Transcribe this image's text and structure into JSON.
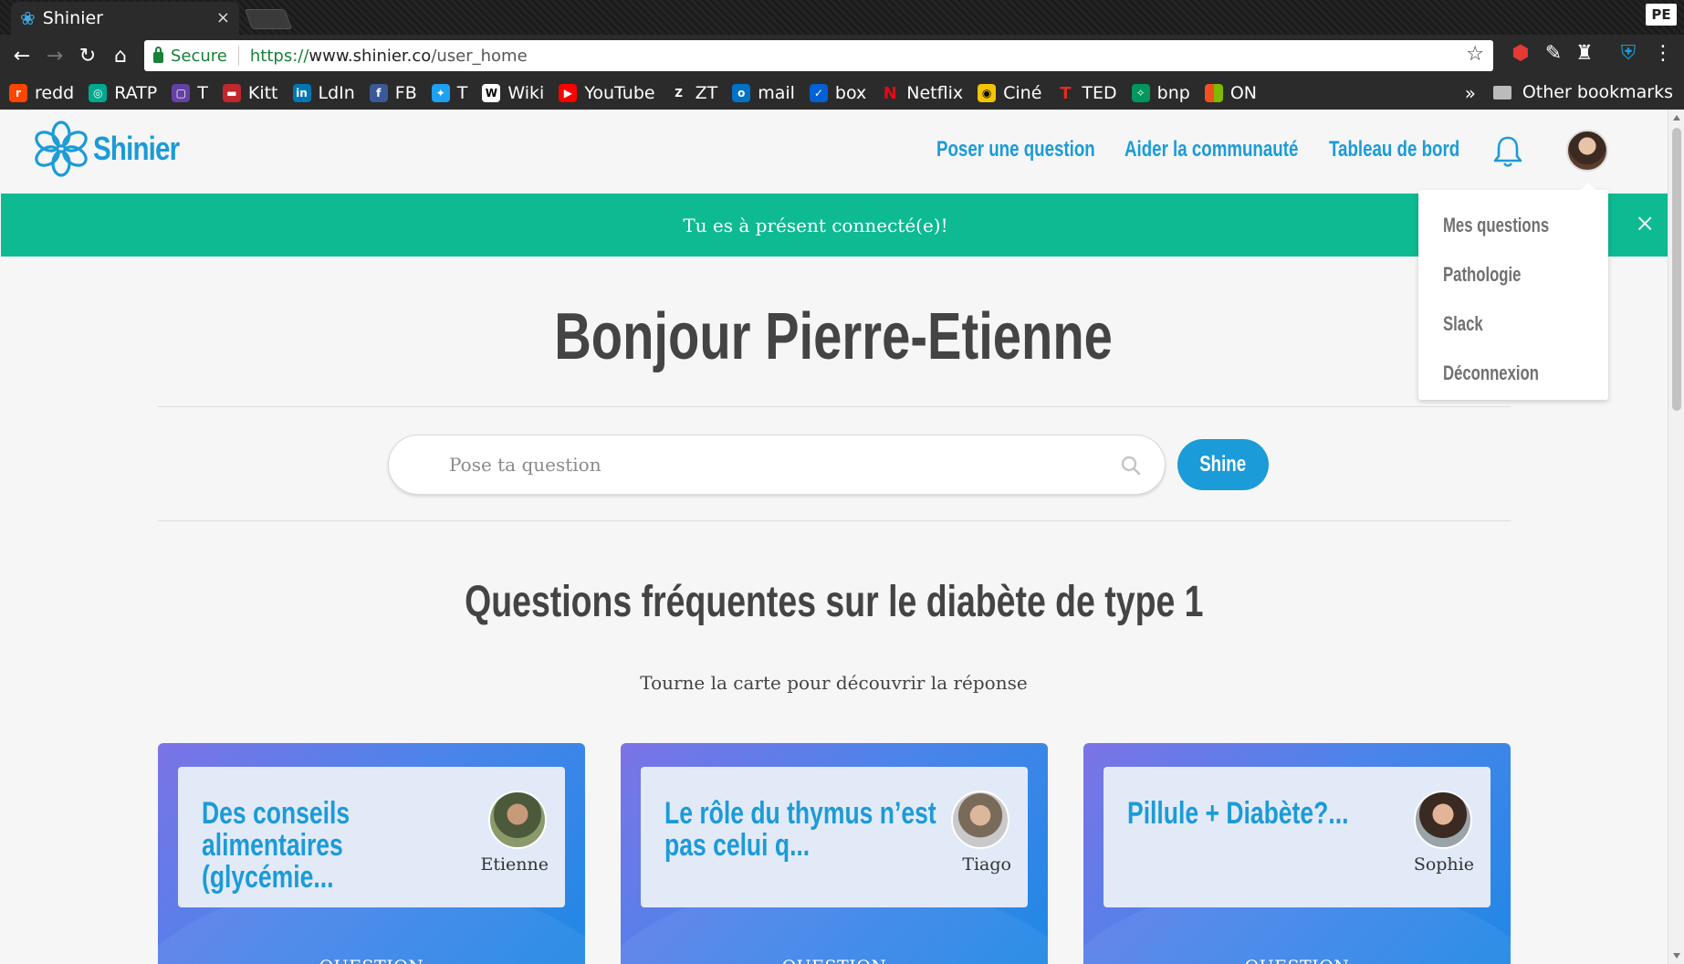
{
  "browser": {
    "tab_title": "Shinier",
    "tab_close": "×",
    "profile": "PE",
    "secure_label": "Secure",
    "url_proto": "https://",
    "url_host": "www.shinier.co",
    "url_path": "/user_home",
    "bookmarks": [
      {
        "label": "redd",
        "color": "#ff4500",
        "glyph": "r"
      },
      {
        "label": "RATP",
        "color": "#00a88f",
        "glyph": "◎"
      },
      {
        "label": "T",
        "color": "#6441a5",
        "glyph": "▢"
      },
      {
        "label": "Kitt",
        "color": "#c1272d",
        "glyph": "▬"
      },
      {
        "label": "LdIn",
        "color": "#0077b5",
        "glyph": "in"
      },
      {
        "label": "FB",
        "color": "#3b5998",
        "glyph": "f"
      },
      {
        "label": "T",
        "color": "#1da1f2",
        "glyph": "✦"
      },
      {
        "label": "Wiki",
        "color": "#ffffff",
        "glyph": "W"
      },
      {
        "label": "YouTube",
        "color": "#ff0000",
        "glyph": "▶"
      },
      {
        "label": "ZT",
        "color": "#2b2b2b",
        "glyph": "Z"
      },
      {
        "label": "mail",
        "color": "#0072c6",
        "glyph": "o"
      },
      {
        "label": "box",
        "color": "#0061d5",
        "glyph": "✓"
      },
      {
        "label": "Netflix",
        "color": "#e50914",
        "glyph": "N"
      },
      {
        "label": "Ciné",
        "color": "#f5c400",
        "glyph": "◉"
      },
      {
        "label": "TED",
        "color": "#e62b1e",
        "glyph": "T"
      },
      {
        "label": "bnp",
        "color": "#00965e",
        "glyph": "✧"
      },
      {
        "label": "ON",
        "color": "#f25022",
        "glyph": "▦"
      }
    ],
    "more": "»",
    "other_bookmarks": "Other bookmarks"
  },
  "site": {
    "logo_text": "Shinier",
    "nav": {
      "ask": "Poser une question",
      "help": "Aider la communauté",
      "dashboard": "Tableau de bord"
    },
    "alert": {
      "text": "Tu es à présent connecté(e)!",
      "close": "×"
    },
    "dropdown": [
      "Mes questions",
      "Pathologie",
      "Slack",
      "Déconnexion"
    ],
    "greeting": "Bonjour Pierre-Etienne",
    "search": {
      "placeholder": "Pose ta question",
      "button": "Shine"
    },
    "faq": {
      "title": "Questions fréquentes sur le diabète de type 1",
      "subtitle": "Tourne la carte pour découvrir la réponse",
      "cards": [
        {
          "question": "Des conseils alimentaires (glycémie...",
          "author": "Etienne",
          "label": "QUESTION"
        },
        {
          "question": "Le rôle du thymus n’est pas celui q...",
          "author": "Tiago",
          "label": "QUESTION"
        },
        {
          "question": "Pillule + Diabète?...",
          "author": "Sophie",
          "label": "QUESTION"
        }
      ]
    }
  },
  "colors": {
    "brand": "#1b9bd8",
    "alert": "#0dba92",
    "heading": "#444444"
  }
}
